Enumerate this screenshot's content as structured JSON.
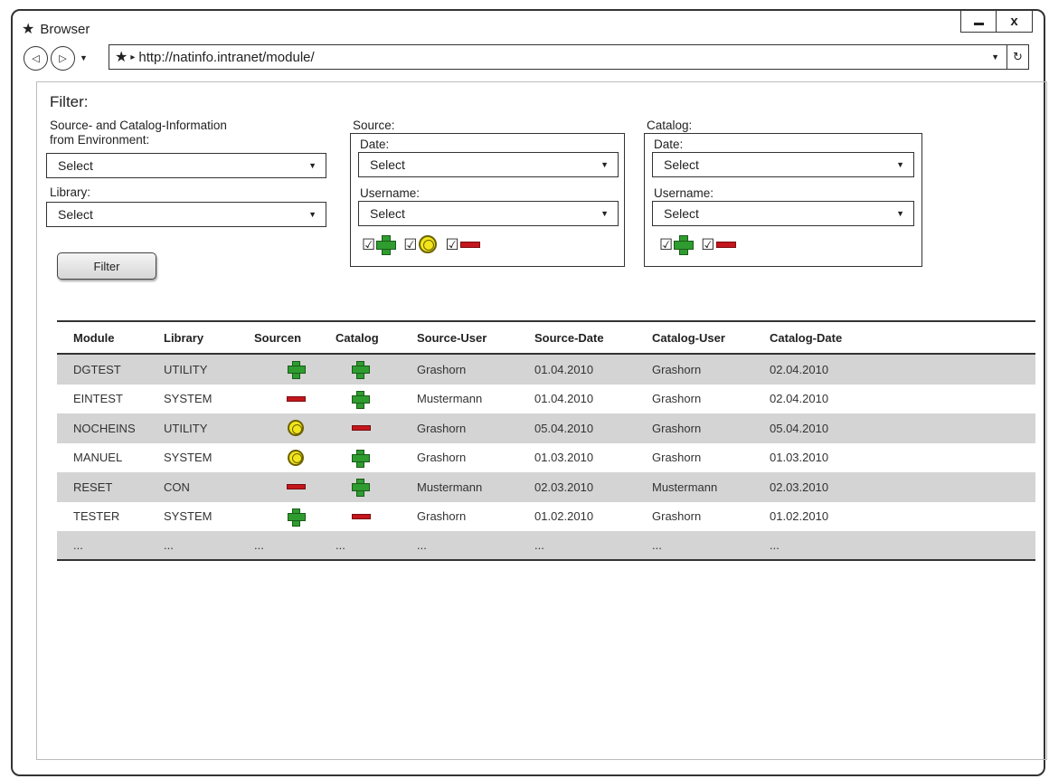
{
  "window": {
    "title": "Browser",
    "close_label": "x"
  },
  "address_bar": {
    "url": "http://natinfo.intranet/module/"
  },
  "filter": {
    "title": "Filter:",
    "env_label_line1": "Source- and Catalog-Information",
    "env_label_line2": "from Environment:",
    "env_select": "Select",
    "library_label": "Library:",
    "library_select": "Select",
    "filter_button": "Filter",
    "source": {
      "group_label": "Source:",
      "date_label": "Date:",
      "date_select": "Select",
      "username_label": "Username:",
      "username_select": "Select",
      "status_checks": [
        "plus-icon",
        "circle-icon",
        "minus-icon"
      ]
    },
    "catalog": {
      "group_label": "Catalog:",
      "date_label": "Date:",
      "date_select": "Select",
      "username_label": "Username:",
      "username_select": "Select",
      "status_checks": [
        "plus-icon",
        "minus-icon"
      ]
    }
  },
  "table": {
    "headers": [
      "Module",
      "Library",
      "Sourcen",
      "Catalog",
      "Source-User",
      "Source-Date",
      "Catalog-User",
      "Catalog-Date"
    ],
    "rows": [
      {
        "module": "DGTEST",
        "library": "UTILITY",
        "source": "plus",
        "catalog": "plus",
        "source_user": "Grashorn",
        "source_date": "01.04.2010",
        "catalog_user": "Grashorn",
        "catalog_date": "02.04.2010"
      },
      {
        "module": "EINTEST",
        "library": "SYSTEM",
        "source": "minus",
        "catalog": "plus",
        "source_user": "Mustermann",
        "source_date": "01.04.2010",
        "catalog_user": "Grashorn",
        "catalog_date": "02.04.2010"
      },
      {
        "module": "NOCHEINS",
        "library": "UTILITY",
        "source": "circle",
        "catalog": "minus",
        "source_user": "Grashorn",
        "source_date": "05.04.2010",
        "catalog_user": "Grashorn",
        "catalog_date": "05.04.2010"
      },
      {
        "module": "MANUEL",
        "library": "SYSTEM",
        "source": "circle",
        "catalog": "plus",
        "source_user": "Grashorn",
        "source_date": "01.03.2010",
        "catalog_user": "Grashorn",
        "catalog_date": "01.03.2010"
      },
      {
        "module": "RESET",
        "library": "CON",
        "source": "minus",
        "catalog": "plus",
        "source_user": "Mustermann",
        "source_date": "02.03.2010",
        "catalog_user": "Mustermann",
        "catalog_date": "02.03.2010"
      },
      {
        "module": "TESTER",
        "library": "SYSTEM",
        "source": "plus",
        "catalog": "minus",
        "source_user": "Grashorn",
        "source_date": "01.02.2010",
        "catalog_user": "Grashorn",
        "catalog_date": "01.02.2010"
      }
    ],
    "ellipsis": "..."
  }
}
